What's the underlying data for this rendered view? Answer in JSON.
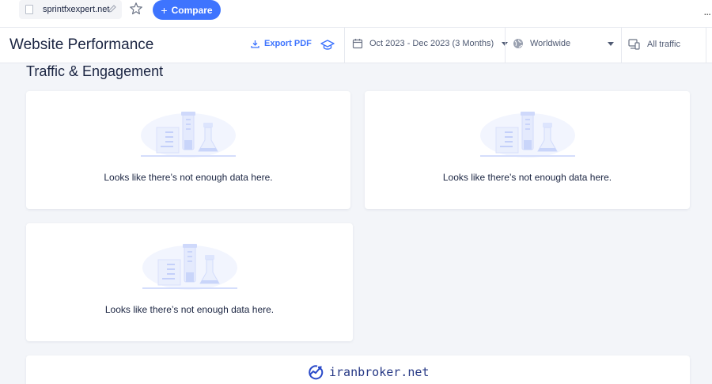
{
  "topbar": {
    "domain": "sprintfxexpert.net",
    "compare_label": "Compare",
    "compare_plus": "+",
    "more_label": "..."
  },
  "header": {
    "title": "Website Performance",
    "export_label": "Export PDF",
    "date_range": "Oct 2023 - Dec 2023 (3 Months)",
    "region": "Worldwide",
    "traffic": "All traffic"
  },
  "section": {
    "title": "Traffic & Engagement"
  },
  "cards": [
    {
      "message": "Looks like there’s not enough data here."
    },
    {
      "message": "Looks like there’s not enough data here."
    },
    {
      "message": "Looks like there’s not enough data here."
    }
  ],
  "watermark": {
    "text": "iranbroker.net"
  },
  "colors": {
    "accent": "#3e74fe",
    "text": "#1b2542",
    "page_bg": "#f3f5f9"
  }
}
